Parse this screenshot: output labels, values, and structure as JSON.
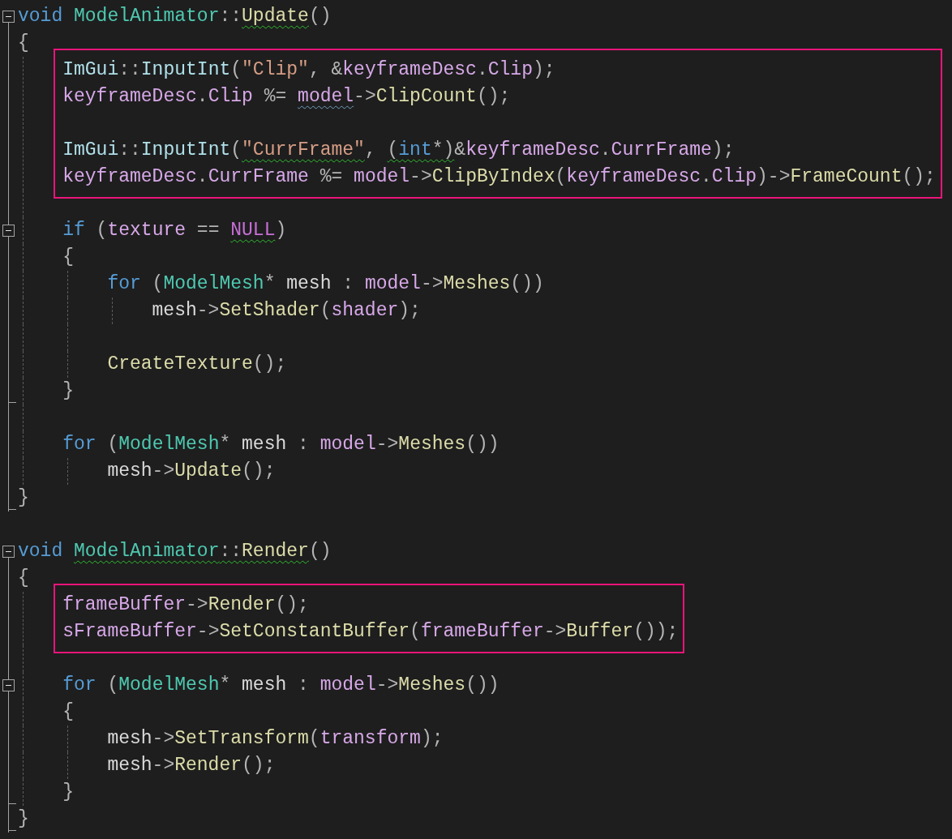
{
  "editor": {
    "lines": [
      {
        "kind": "code",
        "expanded": true,
        "tokens": [
          {
            "text": "void ",
            "kind": "kw"
          },
          {
            "text": "ModelAnimator",
            "kind": "type"
          },
          {
            "text": "::",
            "kind": "p"
          },
          {
            "text": "Update",
            "kind": "func",
            "warning": true
          },
          {
            "text": "()",
            "kind": "p"
          }
        ]
      },
      {
        "kind": "code",
        "tokens": [
          {
            "text": "{",
            "kind": "p"
          }
        ],
        "children": [
          {
            "kind": "highlight",
            "children": [
              {
                "kind": "code",
                "tokens": [
                  {
                    "text": "ImGui",
                    "kind": "ns"
                  },
                  {
                    "text": "::",
                    "kind": "p"
                  },
                  {
                    "text": "InputInt",
                    "kind": "ns"
                  },
                  {
                    "text": "(",
                    "kind": "p"
                  },
                  {
                    "text": "\"Clip\"",
                    "kind": "str"
                  },
                  {
                    "text": ", &",
                    "kind": "p"
                  },
                  {
                    "text": "keyframeDesc",
                    "kind": "var"
                  },
                  {
                    "text": ".",
                    "kind": "p"
                  },
                  {
                    "text": "Clip",
                    "kind": "var"
                  },
                  {
                    "text": ");",
                    "kind": "p"
                  }
                ]
              },
              {
                "kind": "code",
                "tokens": [
                  {
                    "text": "keyframeDesc",
                    "kind": "var"
                  },
                  {
                    "text": ".",
                    "kind": "p"
                  },
                  {
                    "text": "Clip",
                    "kind": "var"
                  },
                  {
                    "text": " %= ",
                    "kind": "p"
                  },
                  {
                    "text": "model",
                    "kind": "var",
                    "hint": true
                  },
                  {
                    "text": "->",
                    "kind": "p"
                  },
                  {
                    "text": "ClipCount",
                    "kind": "func"
                  },
                  {
                    "text": "();",
                    "kind": "p"
                  }
                ]
              },
              {
                "kind": "blank"
              },
              {
                "kind": "code",
                "tokens": [
                  {
                    "text": "ImGui",
                    "kind": "ns"
                  },
                  {
                    "text": "::",
                    "kind": "p"
                  },
                  {
                    "text": "InputInt",
                    "kind": "ns"
                  },
                  {
                    "text": "(",
                    "kind": "p"
                  },
                  {
                    "text": "\"CurrFrame\"",
                    "kind": "str",
                    "warning": true
                  },
                  {
                    "text": ", ",
                    "kind": "p"
                  },
                  {
                    "text": "(",
                    "kind": "p",
                    "warning": true
                  },
                  {
                    "text": "int",
                    "kind": "kw",
                    "warning": true
                  },
                  {
                    "text": "*",
                    "kind": "p",
                    "warning": true
                  },
                  {
                    "text": ")",
                    "kind": "p",
                    "warning": true
                  },
                  {
                    "text": "&",
                    "kind": "p"
                  },
                  {
                    "text": "keyframeDesc",
                    "kind": "var"
                  },
                  {
                    "text": ".",
                    "kind": "p"
                  },
                  {
                    "text": "CurrFrame",
                    "kind": "var"
                  },
                  {
                    "text": ");",
                    "kind": "p"
                  }
                ]
              },
              {
                "kind": "code",
                "tokens": [
                  {
                    "text": "keyframeDesc",
                    "kind": "var"
                  },
                  {
                    "text": ".",
                    "kind": "p"
                  },
                  {
                    "text": "CurrFrame",
                    "kind": "var"
                  },
                  {
                    "text": " %= ",
                    "kind": "p"
                  },
                  {
                    "text": "model",
                    "kind": "var"
                  },
                  {
                    "text": "->",
                    "kind": "p"
                  },
                  {
                    "text": "ClipByIndex",
                    "kind": "func"
                  },
                  {
                    "text": "(",
                    "kind": "p"
                  },
                  {
                    "text": "keyframeDesc",
                    "kind": "var"
                  },
                  {
                    "text": ".",
                    "kind": "p"
                  },
                  {
                    "text": "Clip",
                    "kind": "var"
                  },
                  {
                    "text": ")->",
                    "kind": "p"
                  },
                  {
                    "text": "FrameCount",
                    "kind": "func"
                  },
                  {
                    "text": "();",
                    "kind": "p"
                  }
                ]
              }
            ]
          },
          {
            "kind": "blank"
          },
          {
            "kind": "code",
            "expanded": true,
            "tokens": [
              {
                "text": "if ",
                "kind": "kw"
              },
              {
                "text": "(",
                "kind": "p"
              },
              {
                "text": "texture",
                "kind": "var"
              },
              {
                "text": " == ",
                "kind": "p"
              },
              {
                "text": "NULL",
                "kind": "macro",
                "warning": true
              },
              {
                "text": ")",
                "kind": "p"
              }
            ]
          },
          {
            "kind": "code",
            "tokens": [
              {
                "text": "{",
                "kind": "p"
              }
            ],
            "children": [
              {
                "kind": "code",
                "tokens": [
                  {
                    "text": "for ",
                    "kind": "kw"
                  },
                  {
                    "text": "(",
                    "kind": "p"
                  },
                  {
                    "text": "ModelMesh",
                    "kind": "type"
                  },
                  {
                    "text": "* ",
                    "kind": "p"
                  },
                  {
                    "text": "mesh",
                    "kind": "local"
                  },
                  {
                    "text": " : ",
                    "kind": "p"
                  },
                  {
                    "text": "model",
                    "kind": "var"
                  },
                  {
                    "text": "->",
                    "kind": "p"
                  },
                  {
                    "text": "Meshes",
                    "kind": "func"
                  },
                  {
                    "text": "())",
                    "kind": "p"
                  }
                ],
                "children": [
                  {
                    "kind": "code",
                    "tokens": [
                      {
                        "text": "mesh",
                        "kind": "local"
                      },
                      {
                        "text": "->",
                        "kind": "p"
                      },
                      {
                        "text": "SetShader",
                        "kind": "func"
                      },
                      {
                        "text": "(",
                        "kind": "p"
                      },
                      {
                        "text": "shader",
                        "kind": "var"
                      },
                      {
                        "text": ");",
                        "kind": "p"
                      }
                    ]
                  }
                ]
              },
              {
                "kind": "blank"
              },
              {
                "kind": "code",
                "tokens": [
                  {
                    "text": "CreateTexture",
                    "kind": "func"
                  },
                  {
                    "text": "();",
                    "kind": "p"
                  }
                ]
              }
            ]
          },
          {
            "kind": "code",
            "tokens": [
              {
                "text": "}",
                "kind": "p"
              }
            ]
          },
          {
            "kind": "blank"
          },
          {
            "kind": "code",
            "tokens": [
              {
                "text": "for ",
                "kind": "kw"
              },
              {
                "text": "(",
                "kind": "p"
              },
              {
                "text": "ModelMesh",
                "kind": "type"
              },
              {
                "text": "* ",
                "kind": "p"
              },
              {
                "text": "mesh",
                "kind": "local"
              },
              {
                "text": " : ",
                "kind": "p"
              },
              {
                "text": "model",
                "kind": "var"
              },
              {
                "text": "->",
                "kind": "p"
              },
              {
                "text": "Meshes",
                "kind": "func"
              },
              {
                "text": "())",
                "kind": "p"
              }
            ],
            "children": [
              {
                "kind": "code",
                "tokens": [
                  {
                    "text": "mesh",
                    "kind": "local"
                  },
                  {
                    "text": "->",
                    "kind": "p"
                  },
                  {
                    "text": "Update",
                    "kind": "func"
                  },
                  {
                    "text": "();",
                    "kind": "p"
                  }
                ]
              }
            ]
          }
        ]
      },
      {
        "kind": "code",
        "tokens": [
          {
            "text": "}",
            "kind": "p"
          }
        ]
      },
      {
        "kind": "blank"
      },
      {
        "kind": "code",
        "expanded": true,
        "tokens": [
          {
            "text": "void ",
            "kind": "kw"
          },
          {
            "text": "ModelAnimator",
            "kind": "type",
            "warning": true
          },
          {
            "text": "::",
            "kind": "p",
            "warning": true
          },
          {
            "text": "Render",
            "kind": "func",
            "warning": true
          },
          {
            "text": "()",
            "kind": "p"
          }
        ]
      },
      {
        "kind": "code",
        "tokens": [
          {
            "text": "{",
            "kind": "p"
          }
        ],
        "children": [
          {
            "kind": "highlight",
            "children": [
              {
                "kind": "code",
                "tokens": [
                  {
                    "text": "frameBuffer",
                    "kind": "var"
                  },
                  {
                    "text": "->",
                    "kind": "p"
                  },
                  {
                    "text": "Render",
                    "kind": "func"
                  },
                  {
                    "text": "();",
                    "kind": "p"
                  }
                ]
              },
              {
                "kind": "code",
                "tokens": [
                  {
                    "text": "sFrameBuffer",
                    "kind": "var"
                  },
                  {
                    "text": "->",
                    "kind": "p"
                  },
                  {
                    "text": "SetConstantBuffer",
                    "kind": "func"
                  },
                  {
                    "text": "(",
                    "kind": "p"
                  },
                  {
                    "text": "frameBuffer",
                    "kind": "var"
                  },
                  {
                    "text": "->",
                    "kind": "p"
                  },
                  {
                    "text": "Buffer",
                    "kind": "func"
                  },
                  {
                    "text": "());",
                    "kind": "p"
                  }
                ]
              }
            ]
          },
          {
            "kind": "blank"
          },
          {
            "kind": "code",
            "expanded": true,
            "tokens": [
              {
                "text": "for ",
                "kind": "kw"
              },
              {
                "text": "(",
                "kind": "p"
              },
              {
                "text": "ModelMesh",
                "kind": "type"
              },
              {
                "text": "* ",
                "kind": "p"
              },
              {
                "text": "mesh",
                "kind": "local"
              },
              {
                "text": " : ",
                "kind": "p"
              },
              {
                "text": "model",
                "kind": "var"
              },
              {
                "text": "->",
                "kind": "p"
              },
              {
                "text": "Meshes",
                "kind": "func"
              },
              {
                "text": "())",
                "kind": "p"
              }
            ]
          },
          {
            "kind": "code",
            "tokens": [
              {
                "text": "{",
                "kind": "p"
              }
            ],
            "children": [
              {
                "kind": "code",
                "tokens": [
                  {
                    "text": "mesh",
                    "kind": "local"
                  },
                  {
                    "text": "->",
                    "kind": "p"
                  },
                  {
                    "text": "SetTransform",
                    "kind": "func"
                  },
                  {
                    "text": "(",
                    "kind": "p"
                  },
                  {
                    "text": "transform",
                    "kind": "var"
                  },
                  {
                    "text": ");",
                    "kind": "p"
                  }
                ]
              },
              {
                "kind": "code",
                "tokens": [
                  {
                    "text": "mesh",
                    "kind": "local"
                  },
                  {
                    "text": "->",
                    "kind": "p"
                  },
                  {
                    "text": "Render",
                    "kind": "func"
                  },
                  {
                    "text": "();",
                    "kind": "p"
                  }
                ]
              }
            ]
          },
          {
            "kind": "code",
            "tokens": [
              {
                "text": "}",
                "kind": "p"
              }
            ]
          }
        ]
      },
      {
        "kind": "code",
        "tokens": [
          {
            "text": "}",
            "kind": "p"
          }
        ]
      }
    ]
  }
}
